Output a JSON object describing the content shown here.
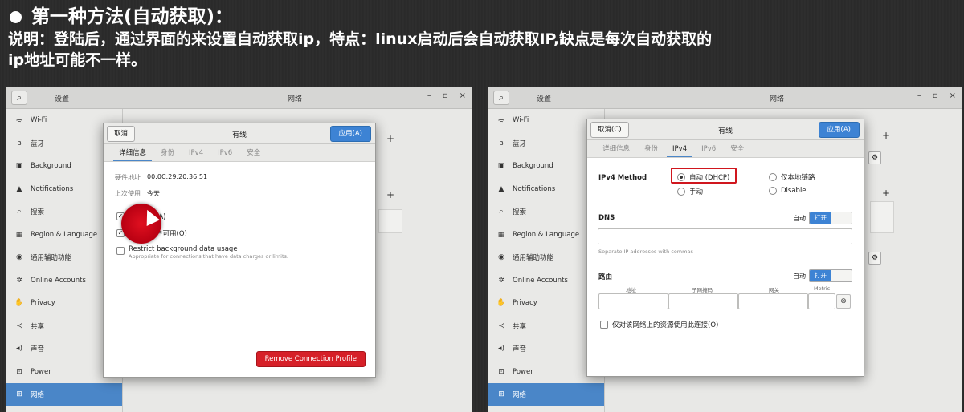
{
  "heading": {
    "title": "第一种方法(自动获取)：",
    "desc_line1": "说明：登陆后，通过界面的来设置自动获取ip，特点：linux启动后会自动获取IP,缺点是每次自动获取的",
    "desc_line2": "ip地址可能不一样。"
  },
  "window": {
    "settings_title": "设置",
    "network_title": "网络",
    "controls": [
      "–",
      "▫",
      "×"
    ]
  },
  "sidebar": {
    "items": [
      {
        "label": "Wi-Fi",
        "icon": "wifi-icon",
        "glyph": "ᯤ"
      },
      {
        "label": "蓝牙",
        "icon": "bluetooth-icon",
        "glyph": "ʙ"
      },
      {
        "label": "Background",
        "icon": "background-icon",
        "glyph": "▣"
      },
      {
        "label": "Notifications",
        "icon": "bell-icon",
        "glyph": "▲"
      },
      {
        "label": "搜索",
        "icon": "search-icon",
        "glyph": "⌕"
      },
      {
        "label": "Region & Language",
        "icon": "region-icon",
        "glyph": "▦"
      },
      {
        "label": "通用辅助功能",
        "icon": "accessibility-icon",
        "glyph": "◉"
      },
      {
        "label": "Online Accounts",
        "icon": "online-accounts-icon",
        "glyph": "✲"
      },
      {
        "label": "Privacy",
        "icon": "privacy-icon",
        "glyph": "✋"
      },
      {
        "label": "共享",
        "icon": "share-icon",
        "glyph": "≺"
      },
      {
        "label": "声音",
        "icon": "sound-icon",
        "glyph": "◂)"
      },
      {
        "label": "Power",
        "icon": "power-icon",
        "glyph": "⊡"
      },
      {
        "label": "网络",
        "icon": "network-icon",
        "glyph": "⊞"
      }
    ],
    "active_index": 12
  },
  "dialog_left": {
    "cancel_label": "取消",
    "title": "有线",
    "apply_label": "应用(A)",
    "tabs": [
      "详细信息",
      "身份",
      "IPv4",
      "IPv6",
      "安全"
    ],
    "active_tab": 0,
    "hw_label": "硬件地址",
    "hw_value": "00:0C:29:20:36:51",
    "last_used_label": "上次使用",
    "last_used_value": "今天",
    "auto_connect": "自动连接(A)",
    "all_users": "对其他用户可用(O)",
    "restrict": "Restrict background data usage",
    "restrict_sub": "Appropriate for connections that have data charges or limits.",
    "remove_label": "Remove Connection Profile"
  },
  "dialog_right": {
    "cancel_label": "取消(C)",
    "title": "有线",
    "apply_label": "应用(A)",
    "tabs": [
      "详细信息",
      "身份",
      "IPv4",
      "IPv6",
      "安全"
    ],
    "active_tab": 2,
    "method_label": "IPv4 Method",
    "opt_auto": "自动 (DHCP)",
    "opt_link_local": "仅本地链路",
    "opt_manual": "手动",
    "opt_disable": "Disable",
    "dns_label": "DNS",
    "auto_label": "自动",
    "toggle_on": "打开",
    "dns_note": "Separate IP addresses with commas",
    "route_label": "路由",
    "col_address": "地址",
    "col_netmask": "子网掩码",
    "col_gateway": "网关",
    "col_metric": "Metric",
    "only_local": "仅对该网络上的资源使用此连接(O)"
  },
  "colors": {
    "accent": "#3d83d4",
    "danger": "#d62028",
    "highlight": "#d0161e"
  }
}
